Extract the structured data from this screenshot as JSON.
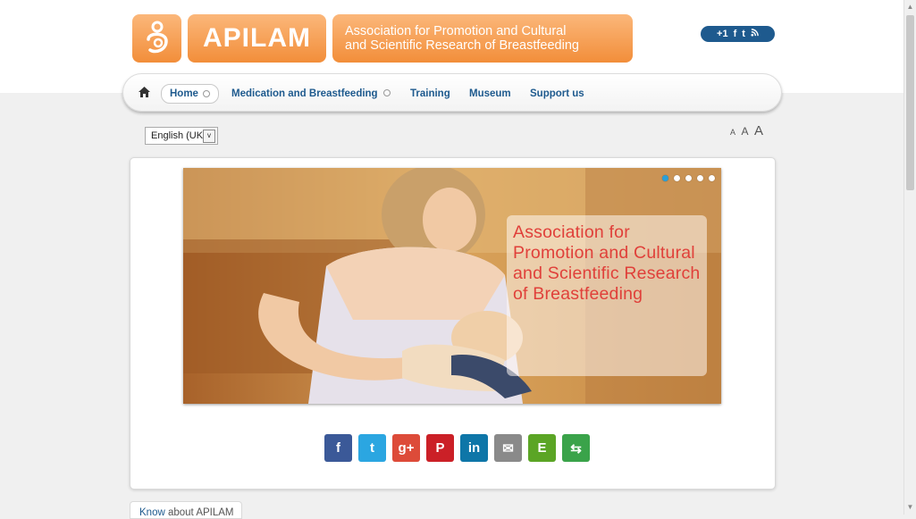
{
  "brand": {
    "name": "APILAM",
    "tagline_line1": "Association for Promotion and Cultural",
    "tagline_line2": "and Scientific Research of Breastfeeding"
  },
  "social": {
    "gplus": "+1",
    "facebook": "f",
    "twitter": "t",
    "rss": "rss"
  },
  "nav": {
    "home_icon": "home-icon",
    "items": [
      {
        "label": "Home"
      },
      {
        "label": "Medication and Breastfeeding"
      },
      {
        "label": "Training"
      },
      {
        "label": "Museum"
      },
      {
        "label": "Support us"
      }
    ]
  },
  "language": {
    "selected": "English (UK)"
  },
  "font_sizes": {
    "small": "A",
    "medium": "A",
    "large": "A"
  },
  "slider": {
    "caption": "Association for Promotion and Cultural and Scientific Research of Breastfeeding",
    "dots_count": 5,
    "active_dot": 1
  },
  "share": [
    {
      "name": "facebook",
      "label": "f",
      "color": "#3b5998"
    },
    {
      "name": "twitter",
      "label": "t",
      "color": "#2ba6e1"
    },
    {
      "name": "google-plus",
      "label": "g+",
      "color": "#dd4b39"
    },
    {
      "name": "pinterest",
      "label": "P",
      "color": "#cb2027"
    },
    {
      "name": "linkedin",
      "label": "in",
      "color": "#0e76a8"
    },
    {
      "name": "email",
      "label": "✉",
      "color": "#8a8a8a"
    },
    {
      "name": "evernote",
      "label": "E",
      "color": "#5ba525"
    },
    {
      "name": "printfriendly",
      "label": "⇆",
      "color": "#3aa34a"
    }
  ],
  "bottom_tab": {
    "highlight": "Know",
    "rest": " about APILAM"
  }
}
